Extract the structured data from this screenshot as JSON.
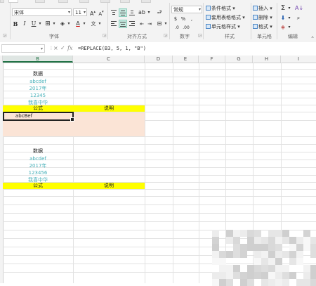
{
  "ribbon": {
    "font": {
      "name": "宋体",
      "size": "11",
      "group_label": "字体"
    },
    "alignment": {
      "group_label": "对齐方式"
    },
    "number": {
      "format": "常规",
      "group_label": "数字"
    },
    "styles": {
      "conditional": "条件格式",
      "table": "套用表格格式",
      "cell": "单元格样式",
      "group_label": "样式"
    },
    "cells": {
      "insert": "插入",
      "delete": "删除",
      "format": "格式",
      "group_label": "单元格"
    },
    "editing": {
      "group_label": "编辑"
    }
  },
  "formula_bar": {
    "cancel": "×",
    "enter": "✓",
    "fx": "fx",
    "formula": "=REPLACE(B3, 5, 1, \"B\")"
  },
  "columns": [
    "B",
    "C",
    "D",
    "E",
    "F",
    "G",
    "H",
    "I"
  ],
  "block1": {
    "header": "数据",
    "values": [
      "abcdef",
      "2017年",
      "12345",
      "我喜中华"
    ],
    "label_left": "公式",
    "label_right": "说明",
    "active_value": "abcBef"
  },
  "block2": {
    "header": "数据",
    "values": [
      "abcdef",
      "2017年",
      "123456",
      "我喜中华"
    ],
    "label_left": "公式",
    "label_right": "说明"
  },
  "colors": {
    "highlight_yellow": "#ffff00",
    "result_fill": "#fbe4d6",
    "teal_text": "#48b0b9",
    "accent_green": "#217346"
  }
}
